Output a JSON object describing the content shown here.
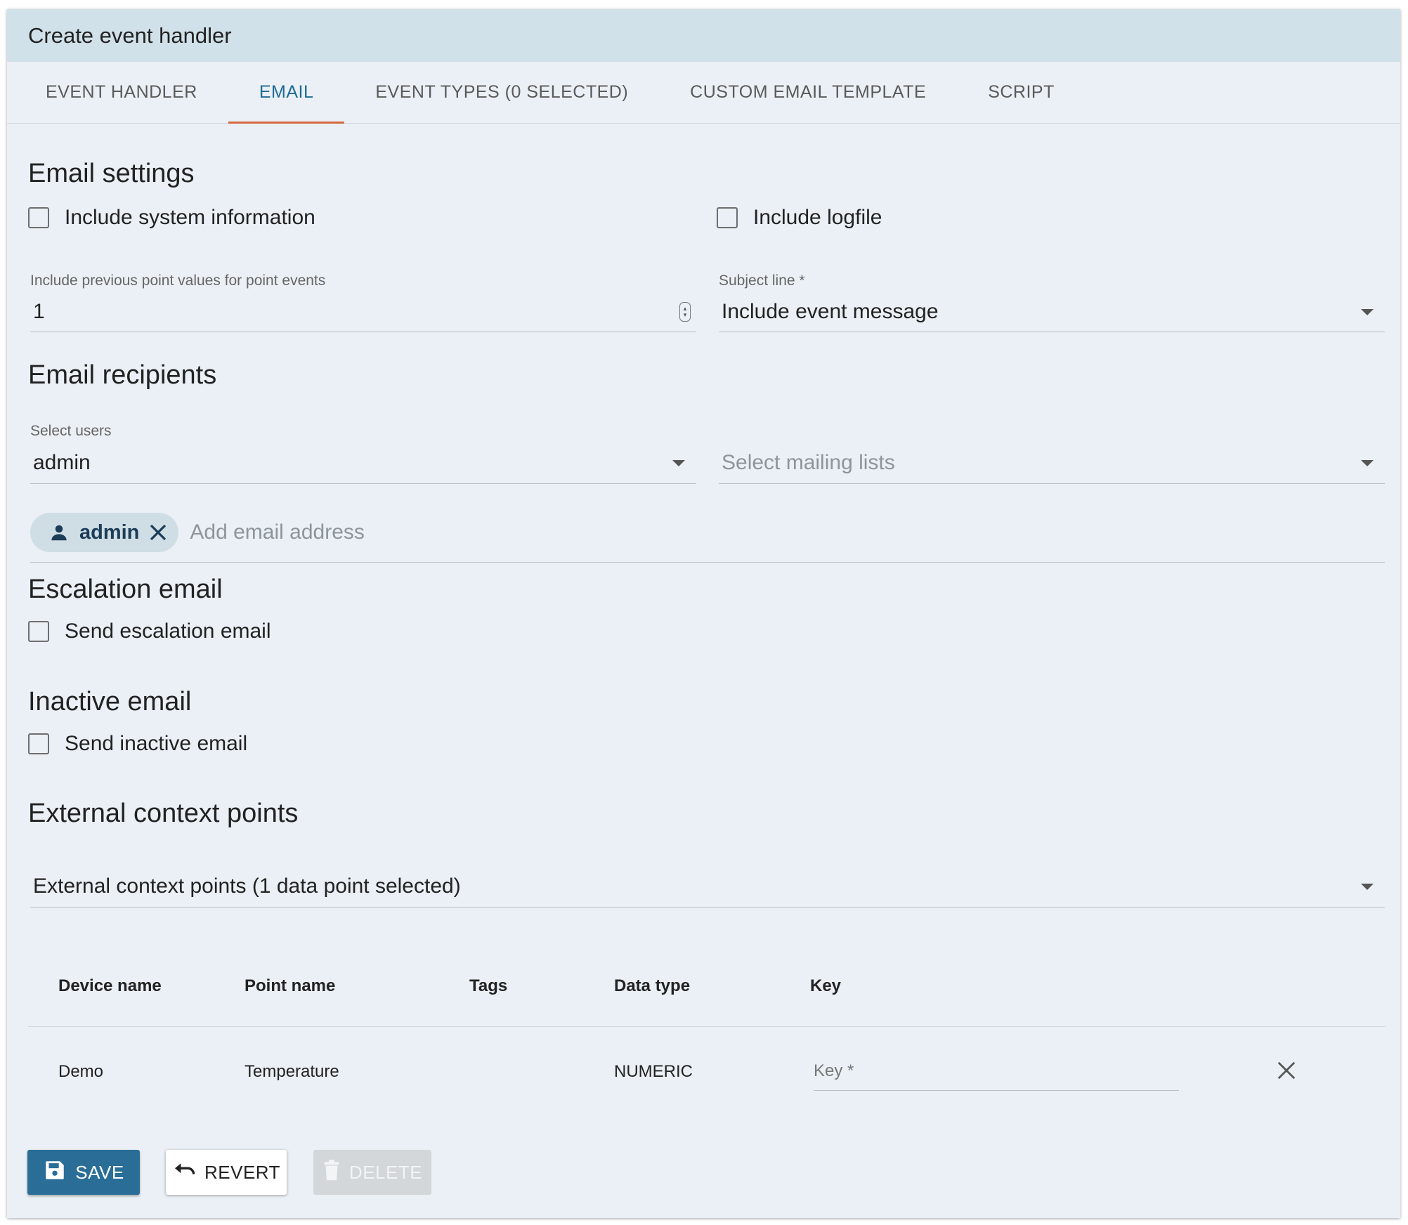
{
  "dialog": {
    "title": "Create event handler"
  },
  "tabs": [
    {
      "label": "EVENT HANDLER"
    },
    {
      "label": "EMAIL"
    },
    {
      "label": "EVENT TYPES (0 SELECTED)"
    },
    {
      "label": "CUSTOM EMAIL TEMPLATE"
    },
    {
      "label": "SCRIPT"
    }
  ],
  "active_tab": "EMAIL",
  "email_settings": {
    "heading": "Email settings",
    "include_system_info": {
      "label": "Include system information",
      "checked": false
    },
    "include_logfile": {
      "label": "Include logfile",
      "checked": false
    },
    "previous_values": {
      "label": "Include previous point values for point events",
      "value": "1"
    },
    "subject_line": {
      "label": "Subject line *",
      "value": "Include event message"
    }
  },
  "email_recipients": {
    "heading": "Email recipients",
    "select_users": {
      "label": "Select users",
      "value": "admin"
    },
    "mailing_lists": {
      "placeholder": "Select mailing lists"
    },
    "chips": [
      {
        "label": "admin"
      }
    ],
    "add_email_placeholder": "Add email address"
  },
  "escalation": {
    "heading": "Escalation email",
    "checkbox": {
      "label": "Send escalation email",
      "checked": false
    }
  },
  "inactive": {
    "heading": "Inactive email",
    "checkbox": {
      "label": "Send inactive email",
      "checked": false
    }
  },
  "context_points": {
    "heading": "External context points",
    "select": {
      "value": "External context points (1 data point selected)"
    },
    "columns": [
      "Device name",
      "Point name",
      "Tags",
      "Data type",
      "Key"
    ],
    "rows": [
      {
        "device": "Demo",
        "point": "Temperature",
        "tags": "",
        "data_type": "NUMERIC",
        "key_placeholder": "Key *"
      }
    ]
  },
  "actions": {
    "save": "SAVE",
    "revert": "REVERT",
    "delete": "DELETE"
  },
  "colors": {
    "accent": "#2a6e98",
    "tab_indicator": "#d66a3e",
    "header_bg": "#d1e1e9",
    "card_bg": "#eaf0f5"
  }
}
